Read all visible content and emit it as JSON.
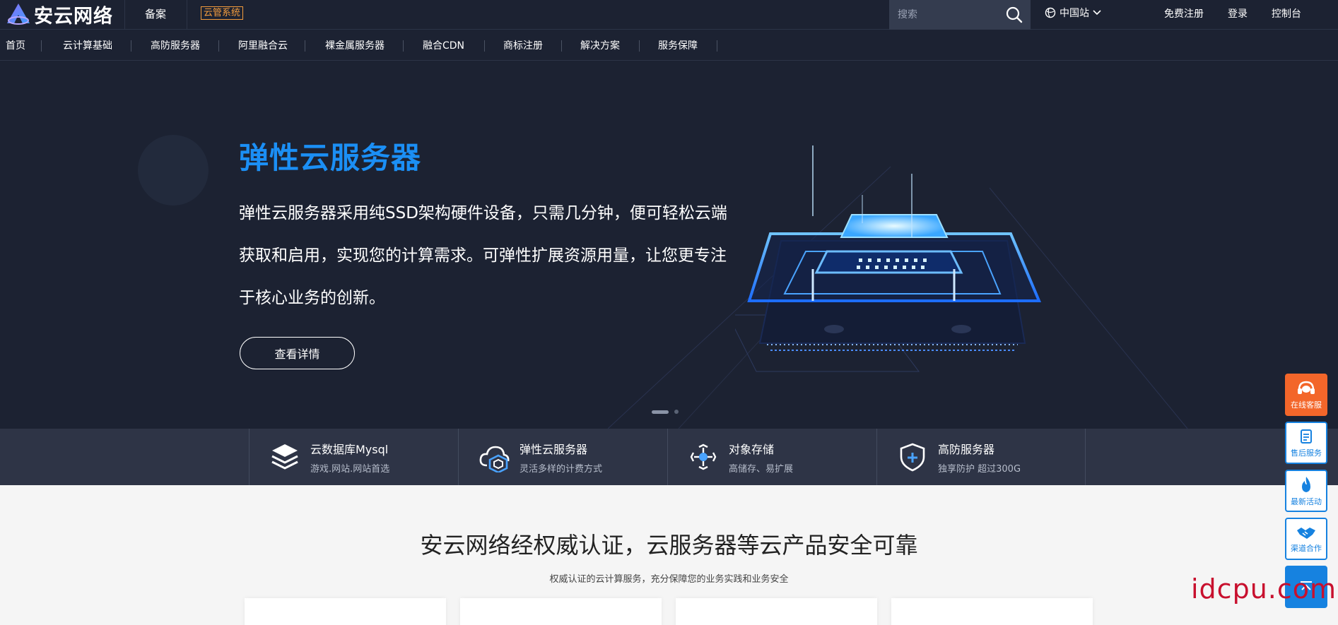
{
  "header": {
    "logo_text": "安云网络",
    "beian": "备案",
    "yunguan_badge": "云管系统",
    "search_placeholder": "搜索",
    "station": "中国站",
    "register": "免费注册",
    "login": "登录",
    "console": "控制台"
  },
  "nav": {
    "items": [
      "首页",
      "云计算基础",
      "高防服务器",
      "阿里融合云",
      "裸金属服务器",
      "融合CDN",
      "商标注册",
      "解决方案",
      "服务保障"
    ]
  },
  "hero": {
    "title": "弹性云服务器",
    "description": "弹性云服务器采用纯SSD架构硬件设备，只需几分钟，便可轻松云端获取和启用，实现您的计算需求。可弹性扩展资源用量，让您更专注于核心业务的创新。",
    "button": "查看详情",
    "slides_total": 2,
    "slide_active": 1
  },
  "features": [
    {
      "icon": "database-icon",
      "title": "云数据库Mysql",
      "subtitle": "游戏.网站.网站首选"
    },
    {
      "icon": "cloud-server-icon",
      "title": "弹性云服务器",
      "subtitle": "灵活多样的计费方式"
    },
    {
      "icon": "object-storage-icon",
      "title": "对象存储",
      "subtitle": "高储存、易扩展"
    },
    {
      "icon": "shield-icon",
      "title": "高防服务器",
      "subtitle": "独享防护 超过300G"
    }
  ],
  "section": {
    "title": "安云网络经权威认证，云服务器等云产品安全可靠",
    "subtitle": "权威认证的云计算服务，充分保障您的业务实践和业务安全"
  },
  "side_tools": [
    {
      "icon": "headset-icon",
      "label": "在线客服"
    },
    {
      "icon": "document-icon",
      "label": "售后服务"
    },
    {
      "icon": "fire-icon",
      "label": "最新活动"
    },
    {
      "icon": "handshake-icon",
      "label": "渠道合作"
    },
    {
      "icon": "back-to-top-icon",
      "label": ""
    }
  ],
  "watermark": "idcpu.com",
  "colors": {
    "background": "#1c2232",
    "accent_blue": "#1b8ff5",
    "orange": "#f3662a",
    "badge_orange": "#f39c3d",
    "feature_bar": "#2e3446",
    "section_bg": "#f5f5f5",
    "watermark_red": "#c8102e"
  }
}
